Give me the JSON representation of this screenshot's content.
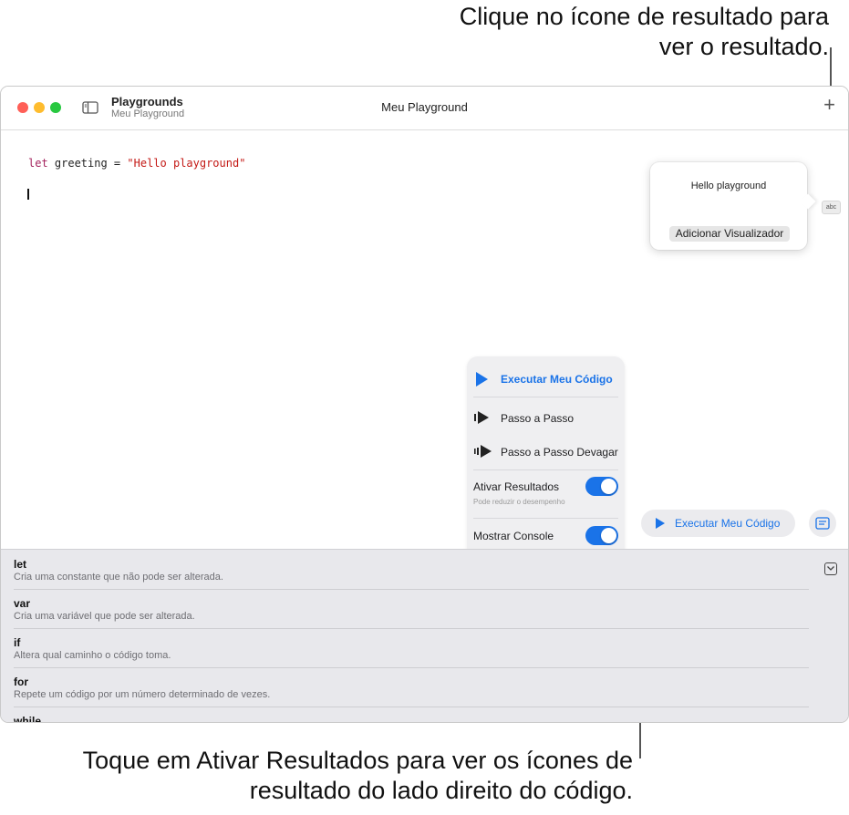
{
  "callouts": {
    "top": "Clique no ícone de resultado para ver o resultado.",
    "bottom": "Toque em Ativar Resultados para ver os ícones de resultado do lado direito do código."
  },
  "window": {
    "app_title": "Playgrounds",
    "app_subtitle": "Meu Playground",
    "doc_title": "Meu Playground",
    "add_icon": "plus-icon"
  },
  "editor": {
    "code": {
      "keyword": "let",
      "identifier": " greeting = ",
      "string": "\"Hello playground\""
    }
  },
  "result_popover": {
    "value": "Hello playground",
    "add_viewer_label": "Adicionar Visualizador",
    "result_icon_label": "abc"
  },
  "run_menu": {
    "run_label": "Executar Meu Código",
    "step_label": "Passo a Passo",
    "step_slow_label": "Passo a Passo Devagar",
    "results_toggle": {
      "label": "Ativar Resultados",
      "sublabel": "Pode reduzir o desempenho",
      "on": true
    },
    "console_toggle": {
      "label": "Mostrar Console",
      "on": true
    }
  },
  "toolbar": {
    "run_button_label": "Executar Meu Código"
  },
  "shortcuts": [
    {
      "keyword": "let",
      "description": "Cria uma constante que não pode ser alterada."
    },
    {
      "keyword": "var",
      "description": "Cria uma variável que pode ser alterada."
    },
    {
      "keyword": "if",
      "description": "Altera qual caminho o código toma."
    },
    {
      "keyword": "for",
      "description": "Repete um código por um número determinado de vezes."
    },
    {
      "keyword": "while",
      "description": ""
    }
  ],
  "colors": {
    "accent": "#1a73e8",
    "close_light": "#ff5f57",
    "minimize_light": "#febc2e",
    "zoom_light": "#28c840"
  }
}
